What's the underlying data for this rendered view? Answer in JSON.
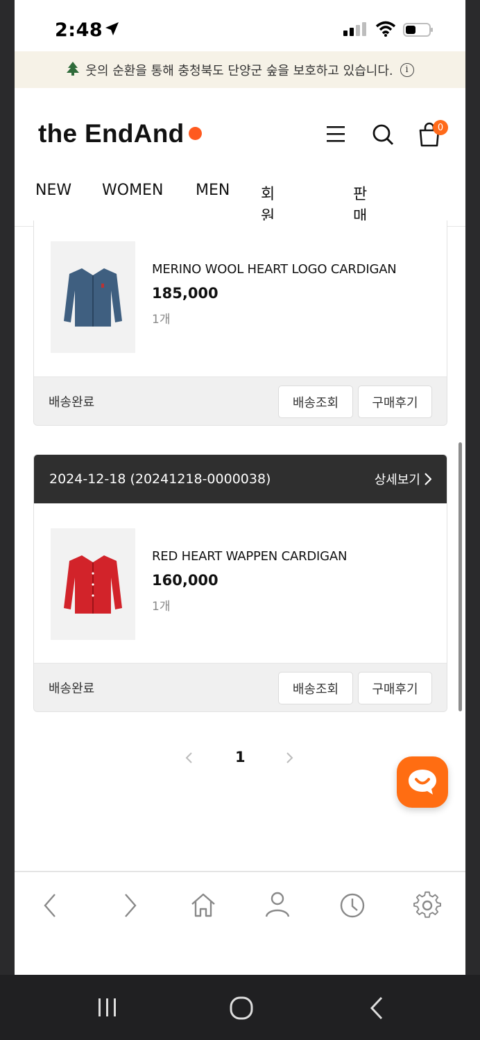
{
  "status_bar": {
    "time": "2:48"
  },
  "banner": {
    "text": "웃의 순환을 통해 충청북도 단양군 숲을 보호하고 있습니다.",
    "info_glyph": "i"
  },
  "header": {
    "logo": "the EndAnd",
    "cart_count": "0",
    "icons": [
      "menu-icon",
      "search-icon",
      "cart-icon"
    ]
  },
  "nav": {
    "items": [
      "NEW",
      "WOMEN",
      "MEN",
      "회원가입",
      "판매하기"
    ]
  },
  "orders": [
    {
      "product": {
        "name": "MERINO WOOL HEART LOGO CARDIGAN",
        "price": "185,000",
        "qty": "1개",
        "color": "#3f5f80"
      },
      "status": "배송완료",
      "track_label": "배송조회",
      "review_label": "구매후기"
    },
    {
      "date_line": "2024-12-18 (20241218-0000038)",
      "detail_label": "상세보기",
      "product": {
        "name": "RED HEART WAPPEN CARDIGAN",
        "price": "160,000",
        "qty": "1개",
        "color": "#d2232a"
      },
      "status": "배송완료",
      "track_label": "배송조회",
      "review_label": "구매후기"
    }
  ],
  "pagination": {
    "current": "1"
  },
  "accent_color": "#ff6a1a",
  "bottom_nav": [
    "back-icon",
    "forward-icon",
    "home-icon",
    "user-icon",
    "history-icon",
    "settings-icon"
  ],
  "android_nav": [
    "recents-icon",
    "home-circle-icon",
    "android-back-icon"
  ]
}
